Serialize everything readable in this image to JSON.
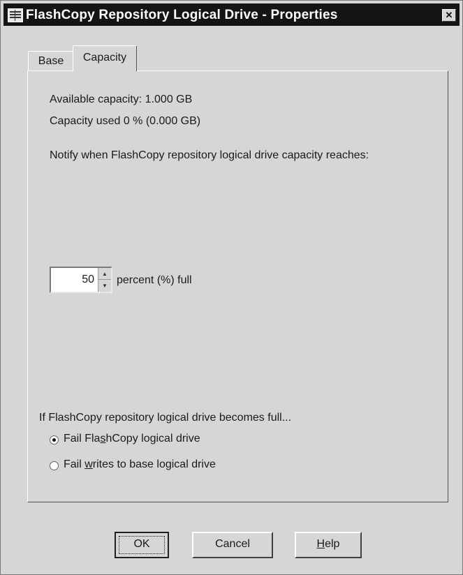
{
  "window": {
    "title": "FlashCopy Repository Logical Drive - Properties",
    "close_label": "✕"
  },
  "tabs": [
    {
      "label": "Base",
      "active": false
    },
    {
      "label": "Capacity",
      "active": true
    }
  ],
  "capacity": {
    "available": "Available capacity: 1.000 GB",
    "used": "Capacity used 0 % (0.000 GB)",
    "notify_label": "Notify when FlashCopy repository logical drive capacity reaches:",
    "threshold_value": "50",
    "threshold_suffix": "percent (%) full",
    "full_label": "If FlashCopy repository logical drive becomes full...",
    "options": [
      {
        "pre": "Fail Fla",
        "u": "s",
        "post": "hCopy logical drive",
        "checked": true
      },
      {
        "pre": "Fail ",
        "u": "w",
        "post": "rites to base logical drive",
        "checked": false
      }
    ]
  },
  "buttons": {
    "ok": "OK",
    "cancel": "Cancel",
    "help_u": "H",
    "help_rest": "elp"
  }
}
